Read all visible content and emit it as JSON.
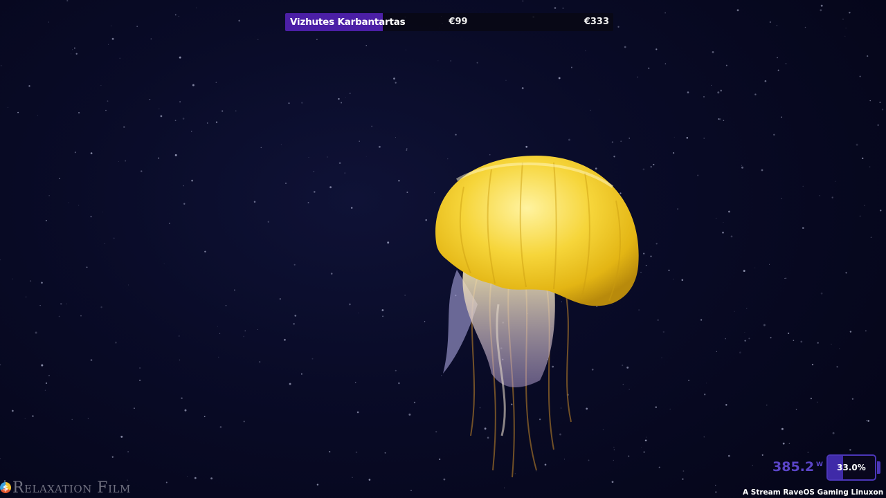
{
  "goal": {
    "name": "Vizhutes Karbantartas",
    "current": "€99",
    "target": "€333",
    "progress": 0.297,
    "fill_color": "#4b1fa6"
  },
  "scene": {
    "background_color": "#05061a",
    "subject_icon": "jellyfish-image",
    "subject_color": "#f3c51a"
  },
  "watermark": {
    "icon": "coin-icon",
    "icon_glyph": "$",
    "text": "Relaxation Film"
  },
  "power": {
    "reading": "385.2",
    "unit": "W",
    "battery_label": "33.0%",
    "battery_level": 0.33,
    "accent_color": "#5b45c8"
  },
  "ticker": {
    "text": "A Stream RaveOS Gaming Linuxon fut"
  }
}
